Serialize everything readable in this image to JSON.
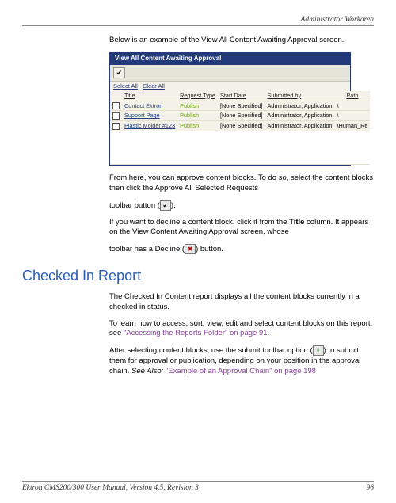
{
  "header": {
    "section": "Administrator Workarea"
  },
  "intro": "Below is an example of the View All Content Awaiting Approval screen.",
  "panel": {
    "title": "View All Content Awaiting Approval",
    "select_all": "Select All",
    "clear_all": "Clear All",
    "columns": {
      "title": "Title",
      "request": "Request Type",
      "start": "Start Date",
      "submitted": "Submitted by",
      "path": "Path"
    },
    "rows": [
      {
        "title": "Contact Ektron",
        "request": "Publish",
        "start": "[None Specified]",
        "submitted": "Administrator, Application",
        "path": "\\"
      },
      {
        "title": "Support Page",
        "request": "Publish",
        "start": "[None Specified]",
        "submitted": "Administrator, Application",
        "path": "\\"
      },
      {
        "title": "Plastic Molder #123",
        "request": "Publish",
        "start": "[None Specified]",
        "submitted": "Administrator, Application",
        "path": "\\Human_Re"
      }
    ]
  },
  "para_approve_1": "From here, you can approve content blocks. To do so, select the content blocks then click the Approve All Selected Requests",
  "para_approve_2a": "toolbar button (",
  "para_approve_2b": ").",
  "para_decline_1a": "If you want to decline a content block, click it from the ",
  "para_decline_1b": "Title",
  "para_decline_1c": " column. It appears on the View Content Awaiting Approval screen, whose",
  "para_decline_2a": "toolbar has a Decline (",
  "para_decline_2b": ") button.",
  "heading": "Checked In Report",
  "para_checked": "The Checked In Content report displays all the content blocks currently in a checked in status.",
  "para_learn_a": "To learn how to access, sort, view, edit and select content blocks on this report, see ",
  "link_access": "\"Accessing the Reports Folder\" on page 91",
  "para_learn_b": ".",
  "para_submit_a": "After selecting content blocks, use the submit toolbar option (",
  "para_submit_b": ") to submit them for approval or publication, depending on your position in the approval chain. ",
  "see_also_label": "See Also: ",
  "link_example": "\"Example of an Approval Chain\" on page 198",
  "footer": {
    "left": "Ektron CMS200/300 User Manual, Version 4.5, Revision 3",
    "right": "96"
  }
}
